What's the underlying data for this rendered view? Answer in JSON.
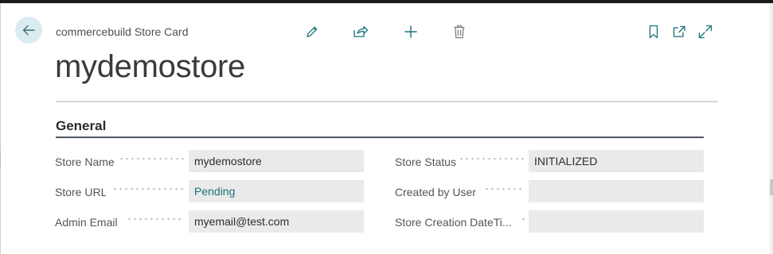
{
  "header": {
    "breadcrumb": "commercebuild Store Card",
    "title": "mydemostore",
    "actions": [
      {
        "name": "edit",
        "icon": "pencil-icon"
      },
      {
        "name": "share",
        "icon": "share-icon"
      },
      {
        "name": "new",
        "icon": "plus-icon"
      },
      {
        "name": "delete",
        "icon": "trash-icon"
      }
    ],
    "window_actions": [
      {
        "name": "bookmark",
        "icon": "bookmark-icon"
      },
      {
        "name": "open-new-window",
        "icon": "open-in-new-window-icon"
      },
      {
        "name": "expand",
        "icon": "expand-icon"
      }
    ]
  },
  "section": {
    "title": "General"
  },
  "fields": {
    "left": [
      {
        "label": "Store Name",
        "value": "mydemostore"
      },
      {
        "label": "Store URL",
        "value": "Pending"
      },
      {
        "label": "Admin Email",
        "value": "myemail@test.com"
      }
    ],
    "right": [
      {
        "label": "Store Status",
        "value": "INITIALIZED"
      },
      {
        "label": "Created by User",
        "value": ""
      },
      {
        "label": "Store Creation DateTi...",
        "value": ""
      }
    ]
  },
  "colors": {
    "accent": "#197278",
    "back_button_bg": "#d9ecef",
    "field_bg": "#eaeaeb"
  }
}
